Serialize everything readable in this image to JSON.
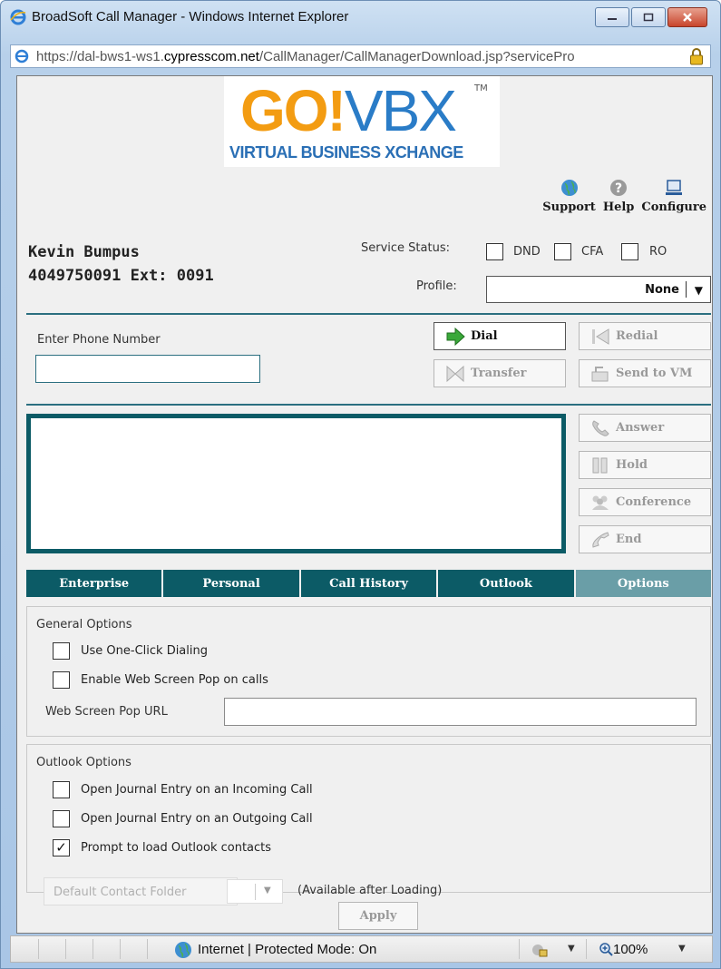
{
  "window": {
    "title": "BroadSoft Call Manager - Windows Internet Explorer",
    "url_prefix": "https://dal-bws1-ws1.",
    "url_domain": "cypresscom.net",
    "url_path": "/CallManager/CallManagerDownload.jsp?servicePro"
  },
  "logo": {
    "go": "GO!",
    "vbx": "VBX",
    "tm": "TM",
    "subtitle": "VIRTUAL BUSINESS XCHANGE"
  },
  "toplinks": {
    "support": "Support",
    "help": "Help",
    "configure": "Configure"
  },
  "user": {
    "name": "Kevin Bumpus",
    "number": "4049750091 Ext: 0091"
  },
  "service_status": {
    "label": "Service Status:",
    "dnd": "DND",
    "cfa": "CFA",
    "ro": "RO"
  },
  "profile": {
    "label": "Profile:",
    "value": "None"
  },
  "phone": {
    "label": "Enter Phone Number",
    "value": ""
  },
  "buttons": {
    "dial": "Dial",
    "redial": "Redial",
    "transfer": "Transfer",
    "send_to_vm": "Send to VM",
    "answer": "Answer",
    "hold": "Hold",
    "conference": "Conference",
    "end": "End",
    "apply": "Apply"
  },
  "tabs": [
    {
      "label": "Enterprise"
    },
    {
      "label": "Personal"
    },
    {
      "label": "Call History"
    },
    {
      "label": "Outlook"
    },
    {
      "label": "Options"
    }
  ],
  "general_options": {
    "title": "General Options",
    "one_click": "Use One-Click Dialing",
    "screen_pop": "Enable Web Screen Pop on calls",
    "url_label": "Web Screen Pop URL",
    "url_value": ""
  },
  "outlook_options": {
    "title": "Outlook Options",
    "journal_incoming": "Open Journal Entry on an Incoming Call",
    "journal_outgoing": "Open Journal Entry on an Outgoing Call",
    "prompt_contacts": "Prompt to load Outlook contacts",
    "prompt_checked_mark": "✓",
    "folder_placeholder": "Default Contact Folder",
    "folder_note": "(Available after Loading)"
  },
  "statusbar": {
    "zone": "Internet | Protected Mode: On",
    "zoom": "100%"
  },
  "colors": {
    "teal": "#0c5b66",
    "tab_selected": "#6a9ea7",
    "logo_orange": "#f39c12",
    "logo_blue": "#2a7cc7"
  }
}
